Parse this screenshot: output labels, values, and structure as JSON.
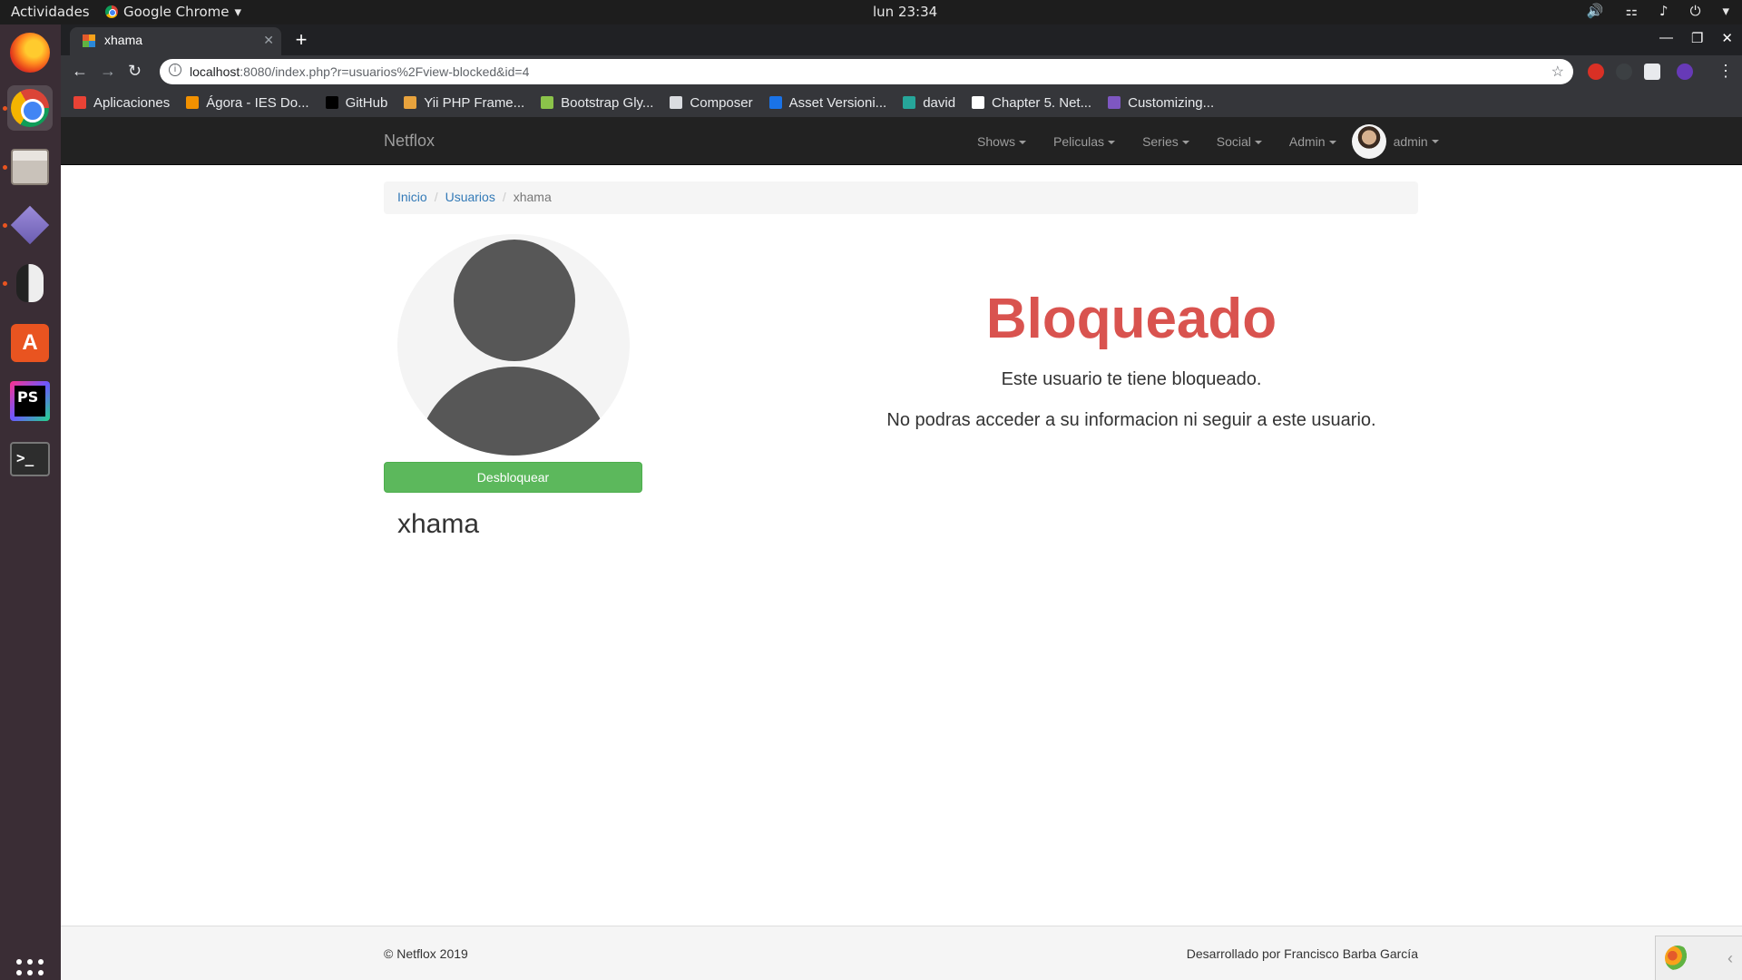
{
  "system": {
    "activities": "Actividades",
    "app_menu": "Google Chrome",
    "clock": "lun 23:34"
  },
  "browser": {
    "tab_title": "xhama",
    "url_host": "localhost",
    "url_rest": ":8080/index.php?r=usuarios%2Fview-blocked&id=4",
    "bookmarks": [
      {
        "label": "Aplicaciones",
        "icon": "apps-grid-icon",
        "color": "#e94235"
      },
      {
        "label": "Ágora - IES Do...",
        "icon": "agora-icon",
        "color": "#f29100"
      },
      {
        "label": "GitHub",
        "icon": "github-icon",
        "color": "#000000"
      },
      {
        "label": "Yii PHP Frame...",
        "icon": "yii-icon",
        "color": "#e8a33d"
      },
      {
        "label": "Bootstrap Gly...",
        "icon": "bootstrap-icon",
        "color": "#8bc34a"
      },
      {
        "label": "Composer",
        "icon": "folder-icon",
        "color": "#dadce0"
      },
      {
        "label": "Asset Versioni...",
        "icon": "shield-icon",
        "color": "#1a73e8"
      },
      {
        "label": "david",
        "icon": "david-icon",
        "color": "#26a69a"
      },
      {
        "label": "Chapter 5. Net...",
        "icon": "globe-icon",
        "color": "#ffffff"
      },
      {
        "label": "Customizing...",
        "icon": "k-icon",
        "color": "#7e57c2"
      }
    ]
  },
  "site": {
    "brand": "Netflox",
    "nav": {
      "shows": "Shows",
      "peliculas": "Peliculas",
      "series": "Series",
      "social": "Social",
      "admin": "Admin",
      "user": "admin"
    },
    "breadcrumb": {
      "home": "Inicio",
      "users": "Usuarios",
      "current": "xhama"
    },
    "profile": {
      "username": "xhama",
      "unblock_label": "Desbloquear"
    },
    "blocked": {
      "title": "Bloqueado",
      "message1": "Este usuario te tiene bloqueado.",
      "message2": "No podras acceder a su informacion ni seguir a este usuario."
    },
    "footer": {
      "copyright": "© Netflox 2019",
      "credits": "Desarrollado por Francisco Barba García"
    }
  },
  "colors": {
    "danger": "#d9534f",
    "success": "#5cb85c",
    "link": "#337ab7",
    "navbar": "#222222"
  }
}
